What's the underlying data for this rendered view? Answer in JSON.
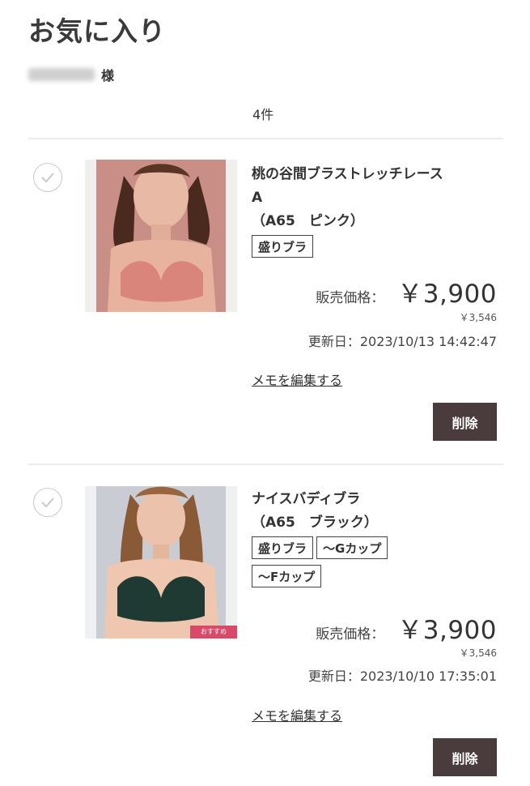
{
  "page": {
    "title": "お気に入り"
  },
  "user": {
    "suffix": "様"
  },
  "list": {
    "count_label": "4件"
  },
  "items": [
    {
      "name_line1": "桃の谷間ブラストレッチレース",
      "name_line2": "A",
      "variant": "（A65　ピンク）",
      "tags": [
        "盛りブラ"
      ],
      "price_label": "販売価格：",
      "price": "￥3,900",
      "tax_excluded_price": "￥3,546",
      "updated": "更新日：2023/10/13 14:42:47",
      "memo_link": "メモを編集する",
      "delete_label": "削除"
    },
    {
      "name_line1": "ナイスバディブラ",
      "variant": "（A65　ブラック）",
      "tags": [
        "盛りブラ",
        "～Gカップ",
        "～Fカップ"
      ],
      "badge": "おすすめ",
      "price_label": "販売価格：",
      "price": "￥3,900",
      "tax_excluded_price": "￥3,546",
      "updated": "更新日：2023/10/10 17:35:01",
      "memo_link": "メモを編集する",
      "delete_label": "削除"
    }
  ],
  "colors": {
    "delete_button_bg": "#4a3c3c",
    "badge_bg": "#d94a6a"
  }
}
